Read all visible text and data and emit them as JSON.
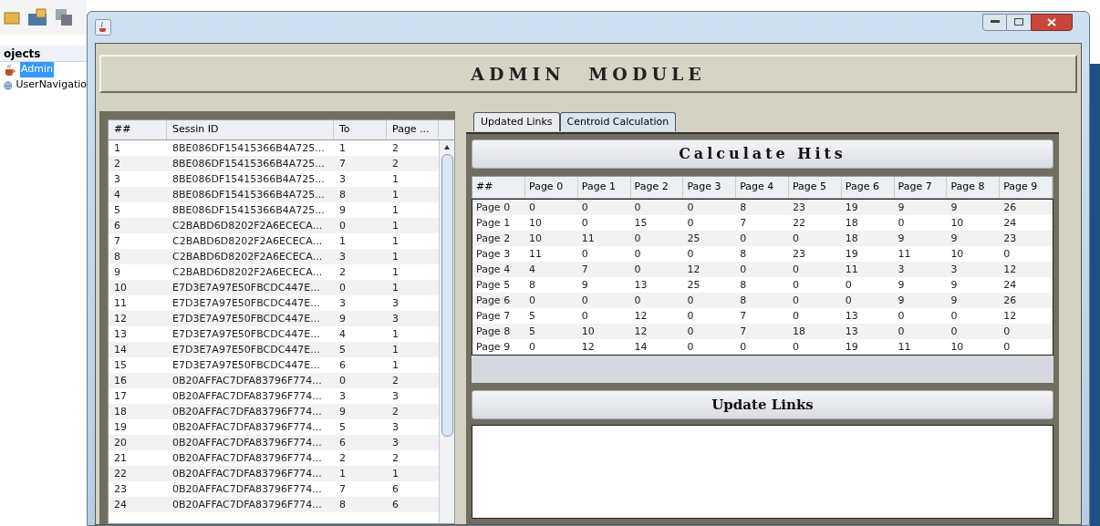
{
  "ide": {
    "panel_title": "ojects",
    "items": [
      {
        "label": "Admin",
        "selected": true,
        "kind": "coffee"
      },
      {
        "label": "UserNavigatio",
        "selected": false,
        "kind": "globe"
      }
    ]
  },
  "window": {
    "header": "ADMIN MODULE"
  },
  "sessions": {
    "columns": [
      "##",
      "Sessin ID",
      "To",
      "Page ..."
    ],
    "rows": [
      [
        "1",
        "8BE086DF15415366B4A725...",
        "1",
        "2"
      ],
      [
        "2",
        "8BE086DF15415366B4A725...",
        "7",
        "2"
      ],
      [
        "3",
        "8BE086DF15415366B4A725...",
        "3",
        "1"
      ],
      [
        "4",
        "8BE086DF15415366B4A725...",
        "8",
        "1"
      ],
      [
        "5",
        "8BE086DF15415366B4A725...",
        "9",
        "1"
      ],
      [
        "6",
        "C2BABD6D8202F2A6ECECA...",
        "0",
        "1"
      ],
      [
        "7",
        "C2BABD6D8202F2A6ECECA...",
        "1",
        "1"
      ],
      [
        "8",
        "C2BABD6D8202F2A6ECECA...",
        "3",
        "1"
      ],
      [
        "9",
        "C2BABD6D8202F2A6ECECA...",
        "2",
        "1"
      ],
      [
        "10",
        "E7D3E7A97E50FBCDC447E...",
        "0",
        "1"
      ],
      [
        "11",
        "E7D3E7A97E50FBCDC447E...",
        "3",
        "3"
      ],
      [
        "12",
        "E7D3E7A97E50FBCDC447E...",
        "9",
        "3"
      ],
      [
        "13",
        "E7D3E7A97E50FBCDC447E...",
        "4",
        "1"
      ],
      [
        "14",
        "E7D3E7A97E50FBCDC447E...",
        "5",
        "1"
      ],
      [
        "15",
        "E7D3E7A97E50FBCDC447E...",
        "6",
        "1"
      ],
      [
        "16",
        "0B20AFFAC7DFA83796F774...",
        "0",
        "2"
      ],
      [
        "17",
        "0B20AFFAC7DFA83796F774...",
        "3",
        "3"
      ],
      [
        "18",
        "0B20AFFAC7DFA83796F774...",
        "9",
        "2"
      ],
      [
        "19",
        "0B20AFFAC7DFA83796F774...",
        "5",
        "3"
      ],
      [
        "20",
        "0B20AFFAC7DFA83796F774...",
        "6",
        "3"
      ],
      [
        "21",
        "0B20AFFAC7DFA83796F774...",
        "2",
        "2"
      ],
      [
        "22",
        "0B20AFFAC7DFA83796F774...",
        "1",
        "1"
      ],
      [
        "23",
        "0B20AFFAC7DFA83796F774...",
        "7",
        "6"
      ],
      [
        "24",
        "0B20AFFAC7DFA83796F774...",
        "8",
        "6"
      ]
    ]
  },
  "tabs": [
    {
      "label": "Updated Links",
      "selected": false
    },
    {
      "label": "Centroid Calculation",
      "selected": true
    }
  ],
  "calculate_button": "Calculate Hits",
  "hits": {
    "columns": [
      "##",
      "Page 0",
      "Page 1",
      "Page 2",
      "Page 3",
      "Page 4",
      "Page 5",
      "Page 6",
      "Page 7",
      "Page 8",
      "Page 9"
    ],
    "rows": [
      [
        "Page 0",
        "0",
        "0",
        "0",
        "0",
        "8",
        "23",
        "19",
        "9",
        "9",
        "26"
      ],
      [
        "Page 1",
        "10",
        "0",
        "15",
        "0",
        "7",
        "22",
        "18",
        "0",
        "10",
        "24"
      ],
      [
        "Page 2",
        "10",
        "11",
        "0",
        "25",
        "0",
        "0",
        "18",
        "9",
        "9",
        "23"
      ],
      [
        "Page 3",
        "11",
        "0",
        "0",
        "0",
        "8",
        "23",
        "19",
        "11",
        "10",
        "0"
      ],
      [
        "Page 4",
        "4",
        "7",
        "0",
        "12",
        "0",
        "0",
        "11",
        "3",
        "3",
        "12"
      ],
      [
        "Page 5",
        "8",
        "9",
        "13",
        "25",
        "8",
        "0",
        "0",
        "9",
        "9",
        "24"
      ],
      [
        "Page 6",
        "0",
        "0",
        "0",
        "0",
        "8",
        "0",
        "0",
        "9",
        "9",
        "26"
      ],
      [
        "Page 7",
        "5",
        "0",
        "12",
        "0",
        "7",
        "0",
        "13",
        "0",
        "0",
        "12"
      ],
      [
        "Page 8",
        "5",
        "10",
        "12",
        "0",
        "7",
        "18",
        "13",
        "0",
        "0",
        "0"
      ],
      [
        "Page 9",
        "0",
        "12",
        "14",
        "0",
        "0",
        "0",
        "19",
        "11",
        "10",
        "0"
      ]
    ]
  },
  "update_button": "Update Links"
}
